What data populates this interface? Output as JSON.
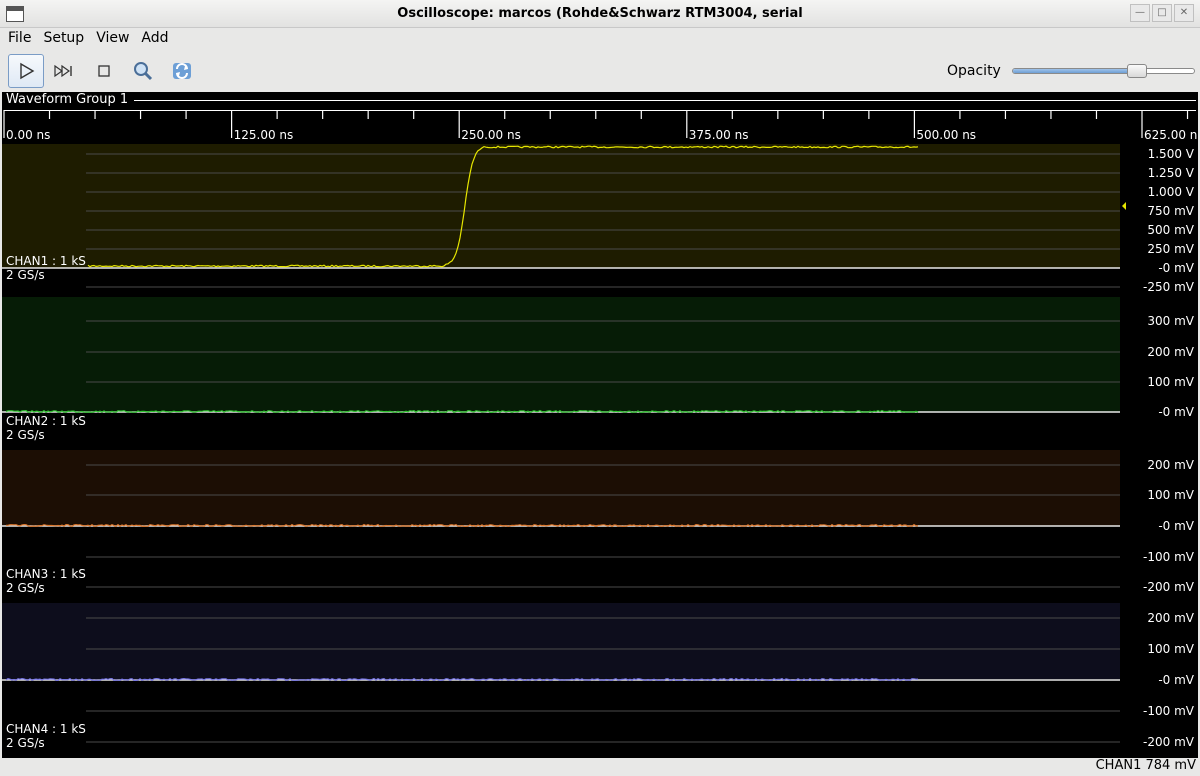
{
  "window": {
    "title": "Oscilloscope: marcos (Rohde&Schwarz RTM3004, serial",
    "buttons": [
      "minimize-icon",
      "maximize-icon",
      "close-icon"
    ]
  },
  "menu": [
    "File",
    "Setup",
    "View",
    "Add"
  ],
  "toolbar": {
    "buttons": [
      "play-icon",
      "single-step-icon",
      "stop-icon",
      "zoom-icon",
      "refresh-icon"
    ],
    "opacity_label": "Opacity",
    "opacity_value": 0.68
  },
  "group": {
    "title": "Waveform Group 1",
    "time_labels": [
      "0.00 ns",
      "125.00 ns",
      "250.00 ns",
      "375.00 ns",
      "500.00 ns",
      "625.00 ns"
    ]
  },
  "channels": [
    {
      "name": "CHAN1 : 1 kS",
      "rate": "2 GS/s",
      "color": "#e6e600",
      "bg": "#1e1c00",
      "axis_labels": [
        "1.500 V",
        "1.250 V",
        "1.000 V",
        "750 mV",
        "500 mV",
        "250 mV",
        "-0 mV",
        "-250 mV"
      ]
    },
    {
      "name": "CHAN2 : 1 kS",
      "rate": "2 GS/s",
      "color": "#2ec42e",
      "bg": "#061c06",
      "axis_labels": [
        "300 mV",
        "200 mV",
        "100 mV",
        "-0 mV"
      ]
    },
    {
      "name": "CHAN3 : 1 kS",
      "rate": "2 GS/s",
      "color": "#e0772a",
      "bg": "#1c0e04",
      "axis_labels": [
        "200 mV",
        "100 mV",
        "-0 mV",
        "-100 mV",
        "-200 mV"
      ]
    },
    {
      "name": "CHAN4 : 1 kS",
      "rate": "2 GS/s",
      "color": "#7a78e8",
      "bg": "#0d0d1c",
      "axis_labels": [
        "200 mV",
        "100 mV",
        "-0 mV",
        "-100 mV",
        "-200 mV"
      ]
    }
  ],
  "status": "CHAN1 784 mV"
}
